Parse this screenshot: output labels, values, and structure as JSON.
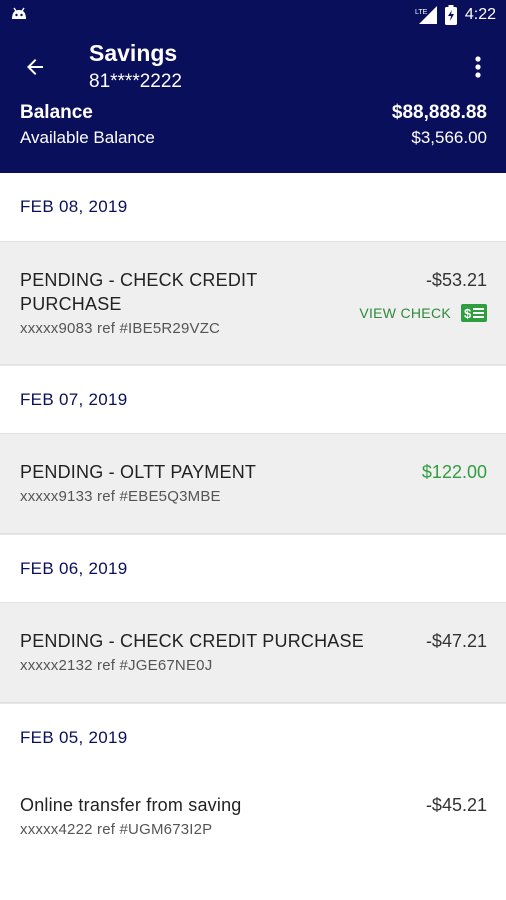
{
  "status_bar": {
    "time": "4:22",
    "network": "LTE",
    "icons": [
      "android-icon",
      "lte-signal-icon",
      "battery-charging-icon"
    ]
  },
  "header": {
    "title": "Savings",
    "account_number": "81****2222",
    "balance_label": "Balance",
    "balance_value": "$88,888.88",
    "available_label": "Available Balance",
    "available_value": "$3,566.00"
  },
  "groups": [
    {
      "date": "FEB 08, 2019",
      "transactions": [
        {
          "description": "PENDING - CHECK CREDIT PURCHASE",
          "description_line1": "PENDING - CHECK CREDIT",
          "description_line2": "PURCHASE",
          "reference": "xxxxx9083 ref #IBE5R29VZC",
          "amount": "-$53.21",
          "type": "debit",
          "action_label": "VIEW CHECK"
        }
      ]
    },
    {
      "date": "FEB 07, 2019",
      "transactions": [
        {
          "description": "PENDING - OLTT PAYMENT",
          "reference": "xxxxx9133 ref #EBE5Q3MBE",
          "amount": "$122.00",
          "type": "credit"
        }
      ]
    },
    {
      "date": "FEB 06, 2019",
      "transactions": [
        {
          "description": "PENDING - CHECK CREDIT PURCHASE",
          "reference": "xxxxx2132 ref #JGE67NE0J",
          "amount": "-$47.21",
          "type": "debit"
        }
      ]
    },
    {
      "date": "FEB 05, 2019",
      "transactions": [
        {
          "description": "Online transfer from saving",
          "reference": "xxxxx4222 ref #UGM673I2P",
          "amount": "-$45.21",
          "type": "debit"
        }
      ]
    }
  ],
  "colors": {
    "primary": "#0a0f5c",
    "credit": "#2e9e3e",
    "row_background": "#efefef"
  }
}
